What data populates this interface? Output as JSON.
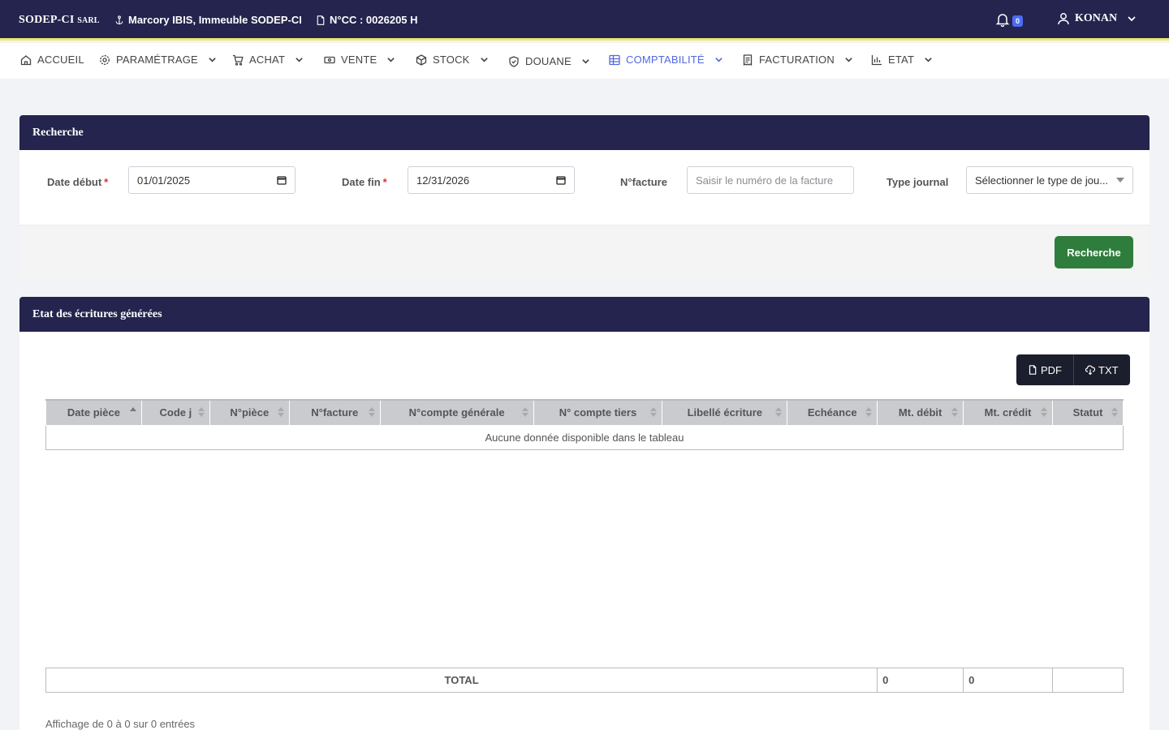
{
  "topbar": {
    "brand": "SODEP-CI",
    "brand_suffix": "SARL",
    "address": "Marcory IBIS, Immeuble SODEP-CI",
    "ncc": "N°CC : 0026205 H",
    "notif_count": "0",
    "user": "KONAN"
  },
  "nav": {
    "items": [
      {
        "label": "ACCUEIL",
        "icon": "home-icon"
      },
      {
        "label": "PARAMÉTRAGE",
        "icon": "gear-icon"
      },
      {
        "label": "ACHAT",
        "icon": "cart-icon"
      },
      {
        "label": "VENTE",
        "icon": "cash-icon"
      },
      {
        "label": "STOCK",
        "icon": "box-icon"
      },
      {
        "label": "DOUANE",
        "icon": "shield-icon"
      },
      {
        "label": "COMPTABILITÉ",
        "icon": "grid-icon"
      },
      {
        "label": "FACTURATION",
        "icon": "receipt-icon"
      },
      {
        "label": "ETAT",
        "icon": "chart-icon"
      }
    ],
    "active": "COMPTABILITÉ"
  },
  "search": {
    "title": "Recherche",
    "date_debut_label": "Date début",
    "date_debut_value": "01/01/2025",
    "date_fin_label": "Date fin",
    "date_fin_value": "12/31/2026",
    "required_mark": "*",
    "facture_label": "N°facture",
    "facture_placeholder": "Saisir le numéro de la facture",
    "journal_label": "Type journal",
    "journal_placeholder": "Sélectionner le type de jou...",
    "submit": "Recherche"
  },
  "results": {
    "title": "Etat des écritures générées",
    "export_pdf": "PDF",
    "export_txt": "TXT",
    "columns": [
      "Date pièce",
      "Code j",
      "N°pièce",
      "N°facture",
      "N°compte générale",
      "N° compte tiers",
      "Libellé écriture",
      "Echéance",
      "Mt. débit",
      "Mt. crédit",
      "Statut"
    ],
    "empty_message": "Aucune donnée disponible dans le tableau",
    "total_label": "TOTAL",
    "total_debit": "0",
    "total_credit": "0",
    "info": "Affichage de 0 à 0 sur 0 entrées"
  },
  "colors": {
    "header_bg": "#24244f",
    "accent_line": "#ece96a",
    "active_nav": "#5468e0",
    "button_green": "#2f7d3c",
    "badge": "#4b6cf5"
  }
}
